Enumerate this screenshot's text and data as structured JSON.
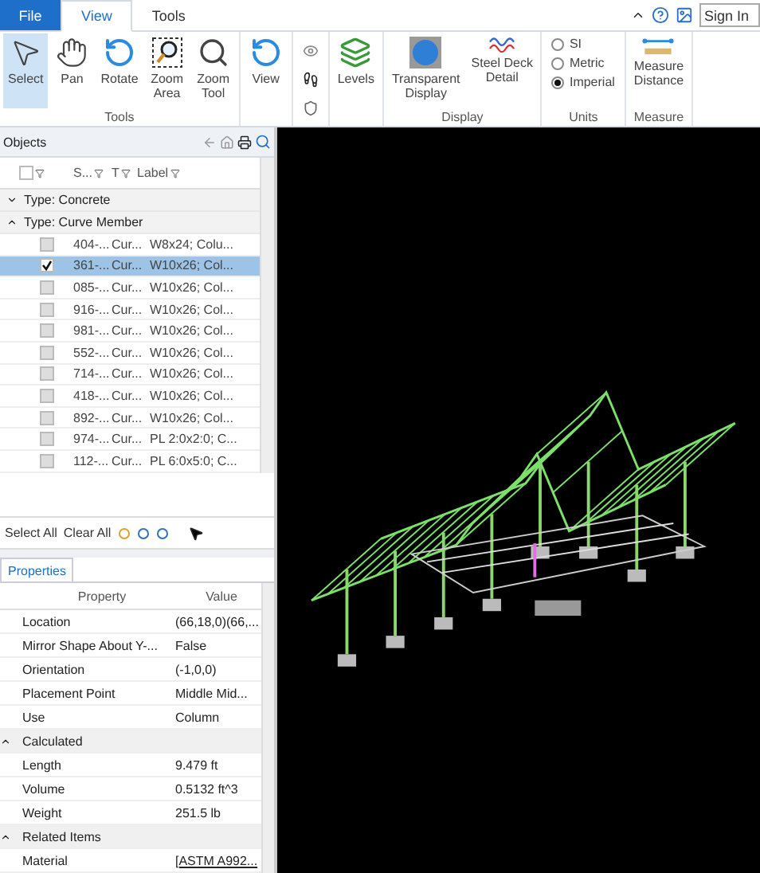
{
  "menu_tabs": [
    {
      "label": "File",
      "kind": "file",
      "selected": false
    },
    {
      "label": "View",
      "kind": "tab",
      "selected": true
    },
    {
      "label": "Tools",
      "kind": "tab",
      "selected": false
    }
  ],
  "sign_in": {
    "placeholder": "Sign In"
  },
  "ribbon_groups": [
    {
      "label": "Tools",
      "kind": "buttons",
      "buttons": [
        {
          "label": "Select",
          "kind": "pointer",
          "selected": true
        },
        {
          "label": "Pan",
          "kind": "hand",
          "selected": false
        },
        {
          "label": "Rotate",
          "kind": "rotate",
          "selected": false
        },
        {
          "label": "Zoom\nArea",
          "kind": "zoomarea",
          "selected": false
        },
        {
          "label": "Zoom\nTool",
          "kind": "zoom",
          "selected": false
        }
      ]
    },
    {
      "kind": "buttons",
      "buttons": [
        {
          "label": "View",
          "kind": "rotate",
          "selected": false
        }
      ]
    },
    {
      "kind": "icons"
    },
    {
      "kind": "buttons",
      "buttons": [
        {
          "label": "Levels",
          "kind": "layers",
          "selected": false
        }
      ]
    },
    {
      "label": "Display",
      "kind": "buttons",
      "buttons": [
        {
          "label": "Transparent\nDisplay",
          "kind": "sphere",
          "selected": false
        },
        {
          "label": "Steel Deck\nDetail",
          "kind": "wave",
          "selected": false
        }
      ]
    },
    {
      "label": "Units",
      "kind": "radios",
      "options": [
        {
          "label": "SI",
          "selected": false
        },
        {
          "label": "Metric",
          "selected": false
        },
        {
          "label": "Imperial",
          "selected": true
        }
      ]
    },
    {
      "label": "Measure",
      "kind": "buttons",
      "buttons": [
        {
          "label": "Measure\nDistance",
          "kind": "ruler",
          "selected": false
        }
      ]
    }
  ],
  "objects": {
    "title": "Objects",
    "all_checked": false,
    "columns": [
      "S...",
      "T",
      "Label"
    ],
    "groups": [
      {
        "label": "Type: Concrete",
        "expanded": false
      },
      {
        "label": "Type: Curve Member",
        "expanded": true,
        "rows": [
          {
            "id": "404-...",
            "type": "Cur...",
            "label": "W8x24; Colu...",
            "checked": false,
            "selected": false
          },
          {
            "id": "361-...",
            "type": "Cur...",
            "label": "W10x26; Col...",
            "checked": true,
            "selected": true
          },
          {
            "id": "085-...",
            "type": "Cur...",
            "label": "W10x26; Col...",
            "checked": false,
            "selected": false
          },
          {
            "id": "916-...",
            "type": "Cur...",
            "label": "W10x26; Col...",
            "checked": false,
            "selected": false
          },
          {
            "id": "981-...",
            "type": "Cur...",
            "label": "W10x26; Col...",
            "checked": false,
            "selected": false
          },
          {
            "id": "552-...",
            "type": "Cur...",
            "label": "W10x26; Col...",
            "checked": false,
            "selected": false
          },
          {
            "id": "714-...",
            "type": "Cur...",
            "label": "W10x26; Col...",
            "checked": false,
            "selected": false
          },
          {
            "id": "418-...",
            "type": "Cur...",
            "label": "W10x26; Col...",
            "checked": false,
            "selected": false
          },
          {
            "id": "892-...",
            "type": "Cur...",
            "label": "W10x26; Col...",
            "checked": false,
            "selected": false
          },
          {
            "id": "974-...",
            "type": "Cur...",
            "label": "PL 2:0x2:0; C...",
            "checked": false,
            "selected": false
          },
          {
            "id": "112-...",
            "type": "Cur...",
            "label": "PL 6:0x5:0; C...",
            "checked": false,
            "selected": false
          }
        ]
      }
    ],
    "actions": [
      "Select All",
      "Clear All"
    ]
  },
  "properties": {
    "tab": "Properties",
    "columns": [
      "Property",
      "Value"
    ],
    "items": [
      {
        "kind": "row",
        "name": "Location",
        "value": "(66,18,0)(66,..."
      },
      {
        "kind": "row",
        "name": "Mirror Shape About Y-...",
        "value": "False"
      },
      {
        "kind": "row",
        "name": "Orientation",
        "value": "(-1,0,0)"
      },
      {
        "kind": "row",
        "name": "Placement Point",
        "value": "Middle Mid..."
      },
      {
        "kind": "row",
        "name": "Use",
        "value": "Column"
      },
      {
        "kind": "group",
        "name": "Calculated",
        "expanded": true
      },
      {
        "kind": "row",
        "name": "Length",
        "value": "9.479 ft"
      },
      {
        "kind": "row",
        "name": "Volume",
        "value": "0.5132 ft^3"
      },
      {
        "kind": "row",
        "name": "Weight",
        "value": "251.5 lb"
      },
      {
        "kind": "group",
        "name": "Related Items",
        "expanded": true
      },
      {
        "kind": "link",
        "name": "Material",
        "value": "[ASTM A992..."
      }
    ]
  }
}
